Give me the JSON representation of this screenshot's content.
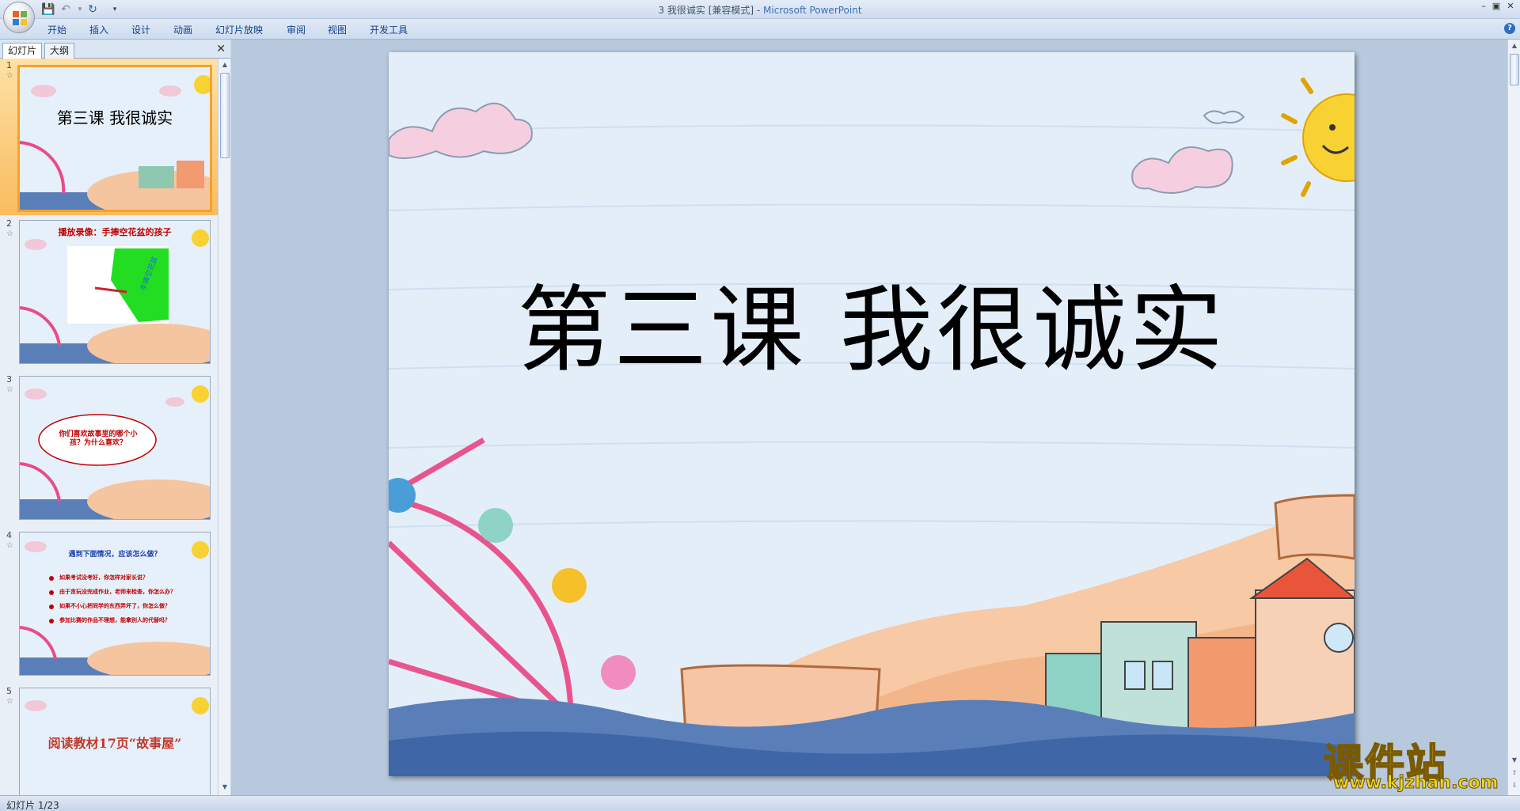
{
  "window": {
    "title_doc": "3 我很诚实 [兼容模式] - ",
    "title_app": "Microsoft PowerPoint"
  },
  "ribbon": {
    "tabs": [
      "开始",
      "插入",
      "设计",
      "动画",
      "幻灯片放映",
      "审阅",
      "视图",
      "开发工具"
    ]
  },
  "left_pane": {
    "tabs": [
      "幻灯片",
      "大纲"
    ],
    "slides": [
      {
        "number": "1",
        "text": "第三课  我很诚实"
      },
      {
        "number": "2",
        "text": "播放录像：手捧空花盆的孩子",
        "video_label": "手捧空花盆"
      },
      {
        "number": "3",
        "text": "你们喜欢故事里的哪个小孩？为什么喜欢？"
      },
      {
        "number": "4",
        "heading": "遇到下面情况，应该怎么做？",
        "bullets": [
          "如果考试没考好，你怎样对家长说？",
          "由于贪玩没完成作业，老师来检查，你怎么办？",
          "如果不小心把同学的东西弄坏了，你怎么做？",
          "参加比赛的作品不理想，能拿别人的代替吗？"
        ]
      },
      {
        "number": "5",
        "text": "阅读教材17页“故事屋”"
      }
    ]
  },
  "slide": {
    "title": "第三课  我很诚实"
  },
  "status": {
    "text": "幻灯片 1/23"
  },
  "watermark": {
    "main": "课件站",
    "url": "www.kjzhan.com"
  },
  "colors": {
    "slide_bg": "#e3eef9",
    "selection": "#f6a12c",
    "ribbon_text": "#15428b"
  }
}
